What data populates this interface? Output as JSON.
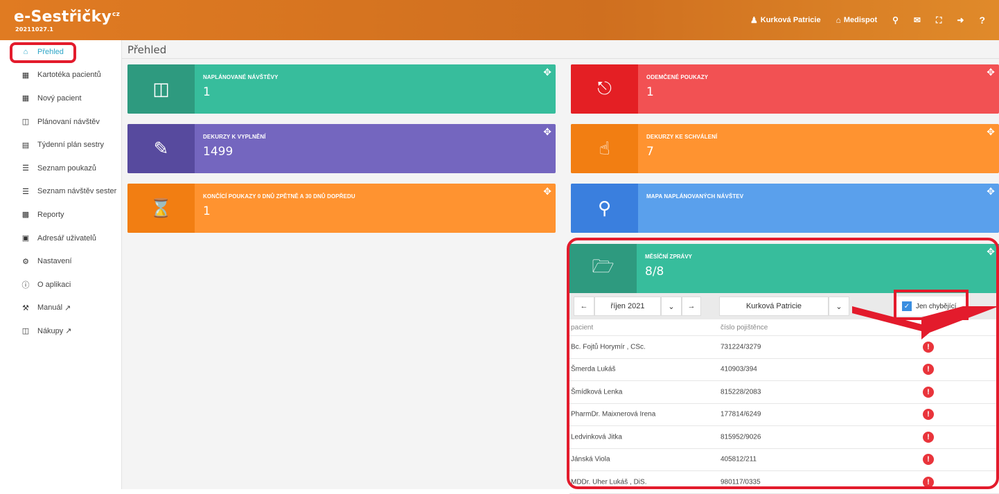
{
  "app": {
    "logo": "e-Sestřičky",
    "logo_suffix": "cz",
    "version": "20211027.1"
  },
  "topnav": {
    "user_label": "Kurková Patricie",
    "org_label": "Medispot"
  },
  "sidebar": {
    "items": [
      {
        "label": "Přehled"
      },
      {
        "label": "Kartotéka pacientů"
      },
      {
        "label": "Nový pacient"
      },
      {
        "label": "Plánovaní návštěv"
      },
      {
        "label": "Týdenní plán sestry"
      },
      {
        "label": "Seznam poukazů"
      },
      {
        "label": "Seznam návštěv sester"
      },
      {
        "label": "Reporty"
      },
      {
        "label": "Adresář uživatelů"
      },
      {
        "label": "Nastavení"
      },
      {
        "label": "O aplikaci"
      },
      {
        "label": "Manuál"
      },
      {
        "label": "Nákupy"
      }
    ]
  },
  "page": {
    "title": "Přehled"
  },
  "tiles": {
    "planned": {
      "label": "NAPLÁNOVANÉ NÁVŠTĚVY",
      "value": "1"
    },
    "unlocked": {
      "label": "ODEMČENÉ POUKAZY",
      "value": "1"
    },
    "to_fill": {
      "label": "DEKURZY K VYPLNĚNÍ",
      "value": "1499"
    },
    "to_approve": {
      "label": "DEKURZY KE SCHVÁLENÍ",
      "value": "7"
    },
    "ending": {
      "label": "KONČÍCÍ POUKAZY 0 DNŮ ZPĚTNĚ A 30 DNŮ DOPŘEDU",
      "value": "1"
    },
    "map": {
      "label": "MAPA NAPLÁNOVANÝCH NÁVŠTEV",
      "value": ""
    }
  },
  "monthly": {
    "label": "MĚSÍČNÍ ZPRÁVY",
    "value": "8/8",
    "month": "říjen 2021",
    "nurse": "Kurková Patricie",
    "only_missing_label": "Jen chybějící",
    "columns": [
      "pacient",
      "číslo pojištěnce"
    ],
    "rows": [
      {
        "patient": "Bc. Fojtů Horymír , CSc.",
        "insurance": "731224/3279"
      },
      {
        "patient": "Šmerda Lukáš",
        "insurance": "410903/394"
      },
      {
        "patient": "Šmídková Lenka",
        "insurance": "815228/2083"
      },
      {
        "patient": "PharmDr. Maixnerová Irena",
        "insurance": "177814/6249"
      },
      {
        "patient": "Ledvinková Jitka",
        "insurance": "815952/9026"
      },
      {
        "patient": "Jánská Viola",
        "insurance": "405812/211"
      },
      {
        "patient": "MDDr. Uher Lukáš , DiS.",
        "insurance": "980117/0335"
      }
    ]
  },
  "colors": {
    "topbar": "#e07b22",
    "green": "#37bd9c",
    "red": "#f25153",
    "purple": "#7466bf",
    "orange": "#ff9330",
    "blue": "#5aa0ec",
    "highlight": "#e31b2c"
  }
}
